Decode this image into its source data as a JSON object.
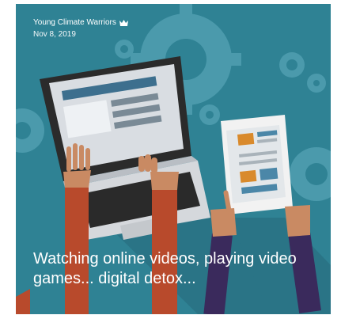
{
  "post": {
    "author": "Young Climate Warriors",
    "date": "Nov 8, 2019",
    "title": "Watching online videos, playing video games... digital detox...",
    "badge_icon": "crown-icon"
  },
  "colors": {
    "background": "#2f8294",
    "gear": "#4b9aac",
    "shadow": "#2a7486",
    "laptop": "#2b2b2b",
    "skin": "#c98a63",
    "left_sleeve": "#b84a2c",
    "right_sleeve": "#3a2a5c"
  }
}
